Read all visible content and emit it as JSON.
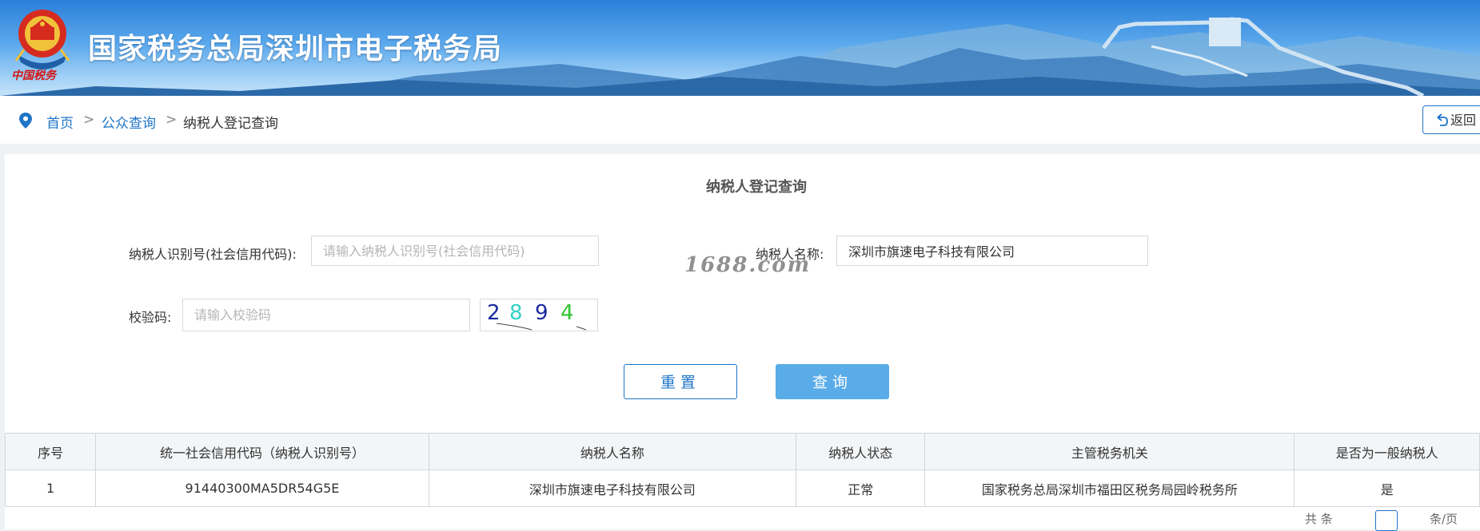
{
  "header": {
    "title": "国家税务总局深圳市电子税务局",
    "emblem_text": "中国税务"
  },
  "breadcrumb": {
    "items": [
      "首页",
      "公众查询",
      "纳税人登记查询"
    ],
    "separator": ">",
    "back_label": "返回"
  },
  "form": {
    "title": "纳税人登记查询",
    "taxpayer_id_label": "纳税人识别号(社会信用代码):",
    "taxpayer_id_placeholder": "请输入纳税人识别号(社会信用代码)",
    "taxpayer_id_value": "",
    "taxpayer_name_label": "纳税人名称:",
    "taxpayer_name_value": "深圳市旗速电子科技有限公司",
    "captcha_label": "校验码:",
    "captcha_placeholder": "请输入校验码",
    "captcha_value": "",
    "captcha_digits": [
      "2",
      "8",
      "9",
      "4"
    ],
    "reset_label": "重置",
    "query_label": "查询"
  },
  "watermark": "1688.com",
  "table": {
    "columns": [
      "序号",
      "统一社会信用代码（纳税人识别号）",
      "纳税人名称",
      "纳税人状态",
      "主管税务机关",
      "是否为一般纳税人"
    ],
    "rows": [
      [
        "1",
        "91440300MA5DR54G5E",
        "深圳市旗速电子科技有限公司",
        "正常",
        "国家税务总局深圳市福田区税务局园岭税务所",
        "是"
      ]
    ]
  },
  "pager": {
    "left_text": "共 条",
    "right_text": "条/页"
  },
  "colors": {
    "accent": "#1e74c7",
    "query_button": "#5aace9",
    "banner_top": "#2b7fd8"
  }
}
